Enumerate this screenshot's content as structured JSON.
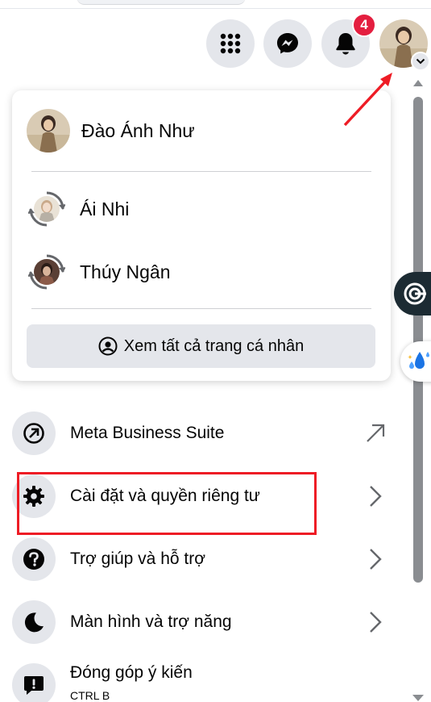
{
  "header": {
    "notification_count": "4",
    "icons": [
      "menu-grid-icon",
      "messenger-icon",
      "bell-icon",
      "account-avatar"
    ]
  },
  "profile_card": {
    "current_user": "Đào Ánh Như",
    "switch_profiles": [
      {
        "name": "Ái Nhi"
      },
      {
        "name": "Thúy Ngân"
      }
    ],
    "see_all_label": "Xem tất cả trang cá nhân"
  },
  "menu": {
    "items": [
      {
        "label": "Meta Business Suite",
        "icon": "meta-business-icon",
        "arrow": "external-arrow-icon"
      },
      {
        "label": "Cài đặt và quyền riêng tư",
        "icon": "gear-icon",
        "arrow": "chevron-right-icon"
      },
      {
        "label": "Trợ giúp và hỗ trợ",
        "icon": "help-icon",
        "arrow": "chevron-right-icon"
      },
      {
        "label": "Màn hình và trợ năng",
        "icon": "moon-icon",
        "arrow": "chevron-right-icon"
      },
      {
        "label": "Đóng góp ý kiến",
        "sub": "CTRL B",
        "icon": "feedback-icon"
      }
    ]
  },
  "colors": {
    "accent_red": "#ee1c25",
    "badge_red": "#e41e3f",
    "button_gray": "#e4e6eb",
    "text": "#050505"
  }
}
